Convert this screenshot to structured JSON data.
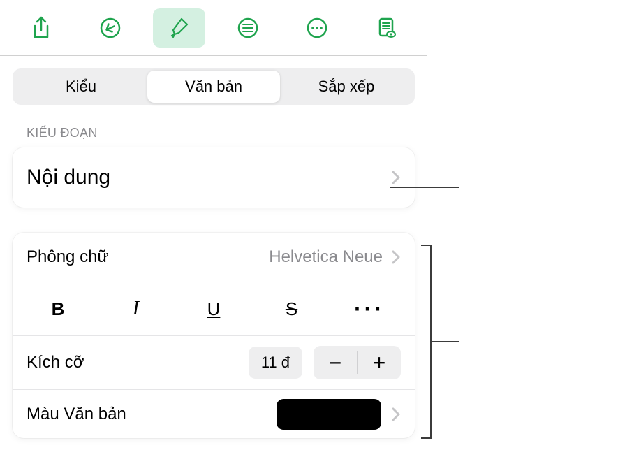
{
  "toolbar": {
    "share": "share-icon",
    "undo": "undo-icon",
    "format": "brush-icon",
    "list": "list-icon",
    "more": "more-icon",
    "view": "document-icon"
  },
  "segments": {
    "style": "Kiểu",
    "text": "Văn bản",
    "arrange": "Sắp xếp"
  },
  "section_label": "KIỂU ĐOẠN",
  "paragraph_style": {
    "current": "Nội dung"
  },
  "font": {
    "label": "Phông chữ",
    "value": "Helvetica Neue"
  },
  "text_styles": {
    "bold": "B",
    "italic": "I",
    "underline": "U",
    "strike": "S",
    "more": "···"
  },
  "size": {
    "label": "Kích cỡ",
    "value": "11 đ",
    "minus": "−",
    "plus": "+"
  },
  "color": {
    "label": "Màu Văn bản",
    "value": "#000000"
  }
}
